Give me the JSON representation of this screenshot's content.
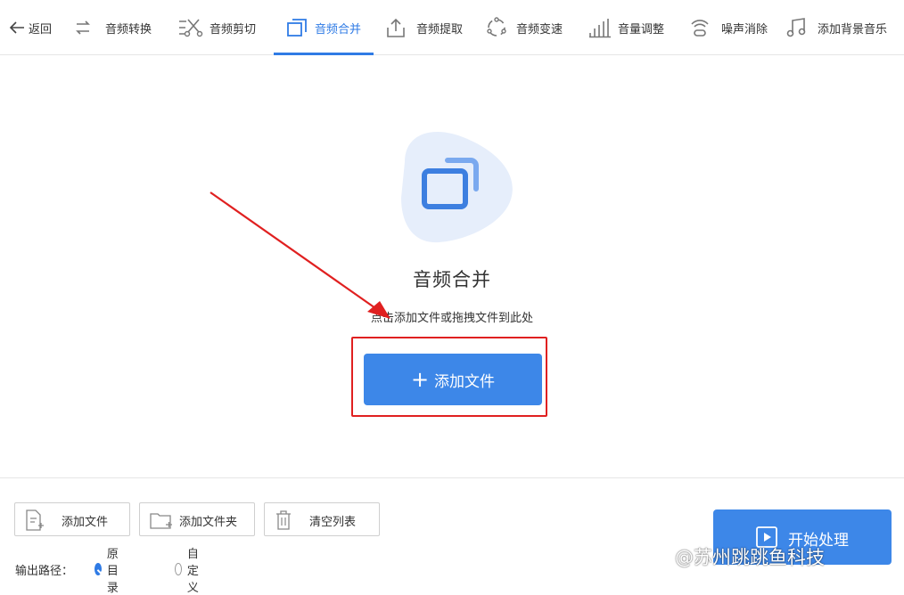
{
  "toolbar": {
    "back_label": "返回",
    "items": [
      {
        "label": "音频转换",
        "icon": "convert-icon"
      },
      {
        "label": "音频剪切",
        "icon": "scissors-icon"
      },
      {
        "label": "音频合并",
        "icon": "merge-icon",
        "active": true
      },
      {
        "label": "音频提取",
        "icon": "upload-icon"
      },
      {
        "label": "音频变速",
        "icon": "speed-icon"
      },
      {
        "label": "音量调整",
        "icon": "volume-bars-icon"
      },
      {
        "label": "噪声消除",
        "icon": "noise-icon"
      },
      {
        "label": "添加背景音乐",
        "icon": "music-note-icon"
      }
    ]
  },
  "main": {
    "title": "音频合并",
    "hint": "点击添加文件或拖拽文件到此处",
    "add_button_label": "添加文件"
  },
  "bottom": {
    "add_file_label": "添加文件",
    "add_folder_label": "添加文件夹",
    "clear_list_label": "清空列表",
    "start_label": "开始处理",
    "output_path_label": "输出路径：",
    "options": [
      {
        "label": "原目录",
        "selected": true
      },
      {
        "label": "自定义",
        "selected": false
      }
    ]
  },
  "watermark": "@苏州跳跳鱼科技",
  "colors": {
    "accent": "#3d87e8",
    "highlight": "#e02020"
  }
}
